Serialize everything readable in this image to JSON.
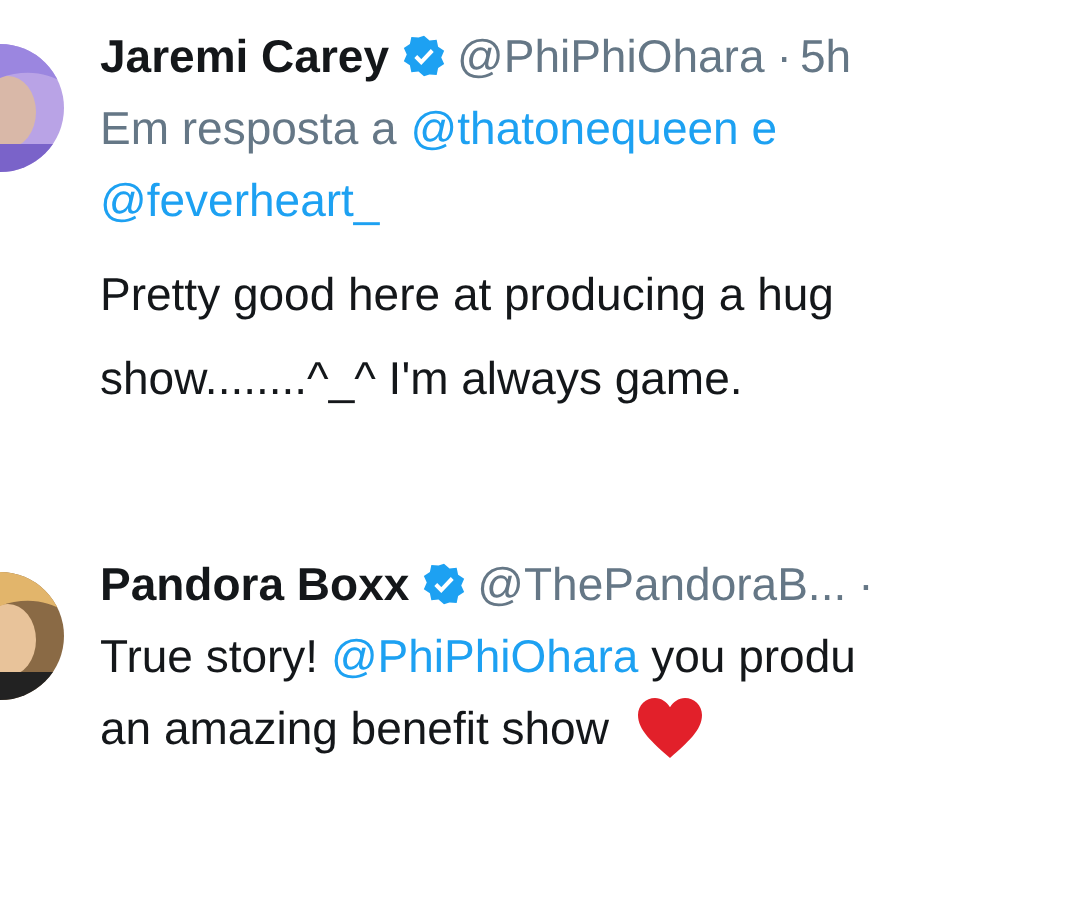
{
  "tweets": [
    {
      "name": "Jaremi Carey",
      "verified": true,
      "handle": "@PhiPhiOhara",
      "separator": "·",
      "time": "5h",
      "reply_label": "Em resposta a",
      "reply_to": [
        "@thatonequeen e",
        "@feverheart_"
      ],
      "body_lines": [
        [
          {
            "kind": "text",
            "text": "Pretty good here at producing a hug"
          }
        ],
        [
          {
            "kind": "text",
            "text": "show........^_^ I'm always game."
          }
        ]
      ]
    },
    {
      "name": "Pandora Boxx",
      "verified": true,
      "handle": "@ThePandoraB...",
      "separator": "·",
      "body_lines": [
        [
          {
            "kind": "text",
            "text": "True story! "
          },
          {
            "kind": "mention",
            "text": "@PhiPhiOhara"
          },
          {
            "kind": "text",
            "text": " you produ"
          }
        ],
        [
          {
            "kind": "text",
            "text": "an amazing benefit show"
          },
          {
            "kind": "heart"
          }
        ]
      ]
    }
  ]
}
